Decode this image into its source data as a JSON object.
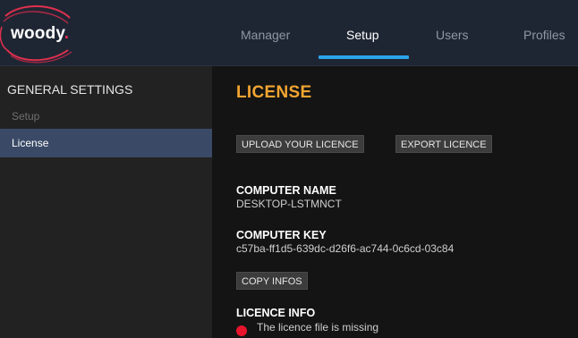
{
  "app": {
    "logo_text": "woody",
    "logo_dot": "."
  },
  "nav": {
    "tabs": [
      {
        "label": "Manager",
        "active": false
      },
      {
        "label": "Setup",
        "active": true
      },
      {
        "label": "Users",
        "active": false
      },
      {
        "label": "Profiles",
        "active": false
      }
    ]
  },
  "sidebar": {
    "section_title": "GENERAL SETTINGS",
    "items": [
      {
        "label": "Setup",
        "active": false
      },
      {
        "label": "License",
        "active": true
      }
    ]
  },
  "main": {
    "title": "LICENSE",
    "buttons": {
      "upload": "UPLOAD YOUR LICENCE",
      "export": "EXPORT LICENCE",
      "copy": "COPY INFOS"
    },
    "computer_name": {
      "heading": "COMPUTER NAME",
      "value": "DESKTOP-LSTMNCT"
    },
    "computer_key": {
      "heading": "COMPUTER KEY",
      "value": "c57ba-ff1d5-639dc-d26f6-ac744-0c6cd-03c84"
    },
    "licence_info": {
      "heading": "LICENCE INFO",
      "status_text": "The licence file is missing",
      "status_icon": "red-dot-icon"
    }
  },
  "colors": {
    "accent_title": "#f2a531",
    "tab_underline": "#2aa4e8",
    "sidebar_active_bg": "#3a4a66",
    "status_error": "#e8142c",
    "logo_ring": "#e0304e"
  }
}
